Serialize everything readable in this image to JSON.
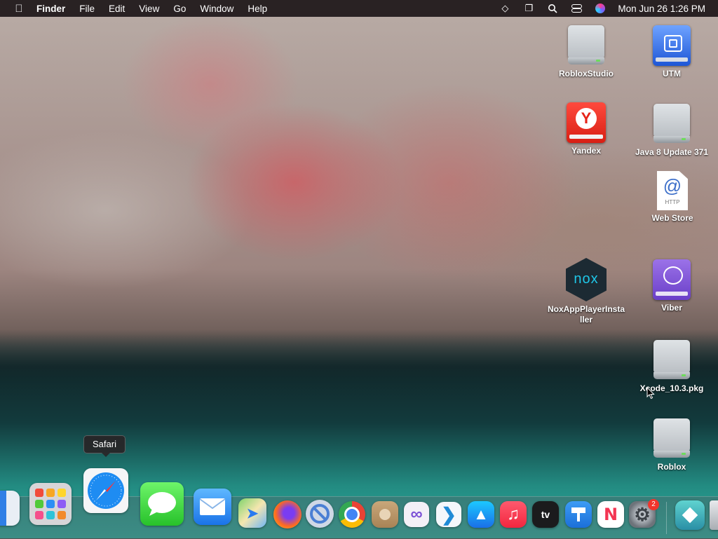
{
  "menubar": {
    "apple_icon": "apple-logo-icon",
    "items": [
      "Finder",
      "File",
      "Edit",
      "View",
      "Go",
      "Window",
      "Help"
    ],
    "datetime": "Mon Jun 26  1:26 PM",
    "status_icons": [
      "diamond-icon",
      "window-stack-icon",
      "search-icon",
      "control-center-icon",
      "siri-icon"
    ]
  },
  "desktop_icons": [
    {
      "label": "RobloxStudio",
      "icon": "disk-icon"
    },
    {
      "label": "UTM",
      "icon": "utm-icon"
    },
    {
      "label": "Yandex",
      "icon": "yandex-icon"
    },
    {
      "label": "Java 8 Update 371",
      "icon": "disk-icon"
    },
    {
      "label": "Web Store",
      "icon": "webloc-icon"
    },
    {
      "label": "NoxAppPlayerInstaller",
      "icon": "nox-icon"
    },
    {
      "label": "Viber",
      "icon": "viber-icon"
    },
    {
      "label": "Xcode_10.3.pkg",
      "icon": "disk-icon"
    },
    {
      "label": "Roblox",
      "icon": "disk-icon"
    }
  ],
  "icon_text": {
    "yandex": "Y",
    "webloc_at": "@",
    "webloc_http": "HTTP",
    "nox": "nox"
  },
  "tooltip": "Safari",
  "dock": {
    "apps": [
      {
        "name": "Finder"
      },
      {
        "name": "Launchpad"
      },
      {
        "name": "Safari"
      },
      {
        "name": "Messages"
      },
      {
        "name": "Mail"
      },
      {
        "name": "Maps"
      },
      {
        "name": "Firefox"
      },
      {
        "name": "Blocked App"
      },
      {
        "name": "Chrome"
      },
      {
        "name": "Contacts"
      },
      {
        "name": "Visual Studio"
      },
      {
        "name": "VS Code"
      },
      {
        "name": "App Store"
      },
      {
        "name": "Music"
      },
      {
        "name": "Apple TV",
        "label": "tv"
      },
      {
        "name": "Keynote"
      },
      {
        "name": "News"
      },
      {
        "name": "System Settings",
        "badge": "2"
      },
      {
        "name": "Remote App"
      },
      {
        "name": "Trash"
      }
    ]
  },
  "colors": {
    "menubar": "#1c1618",
    "badge": "#f2352c",
    "water": "#2ea79b"
  }
}
